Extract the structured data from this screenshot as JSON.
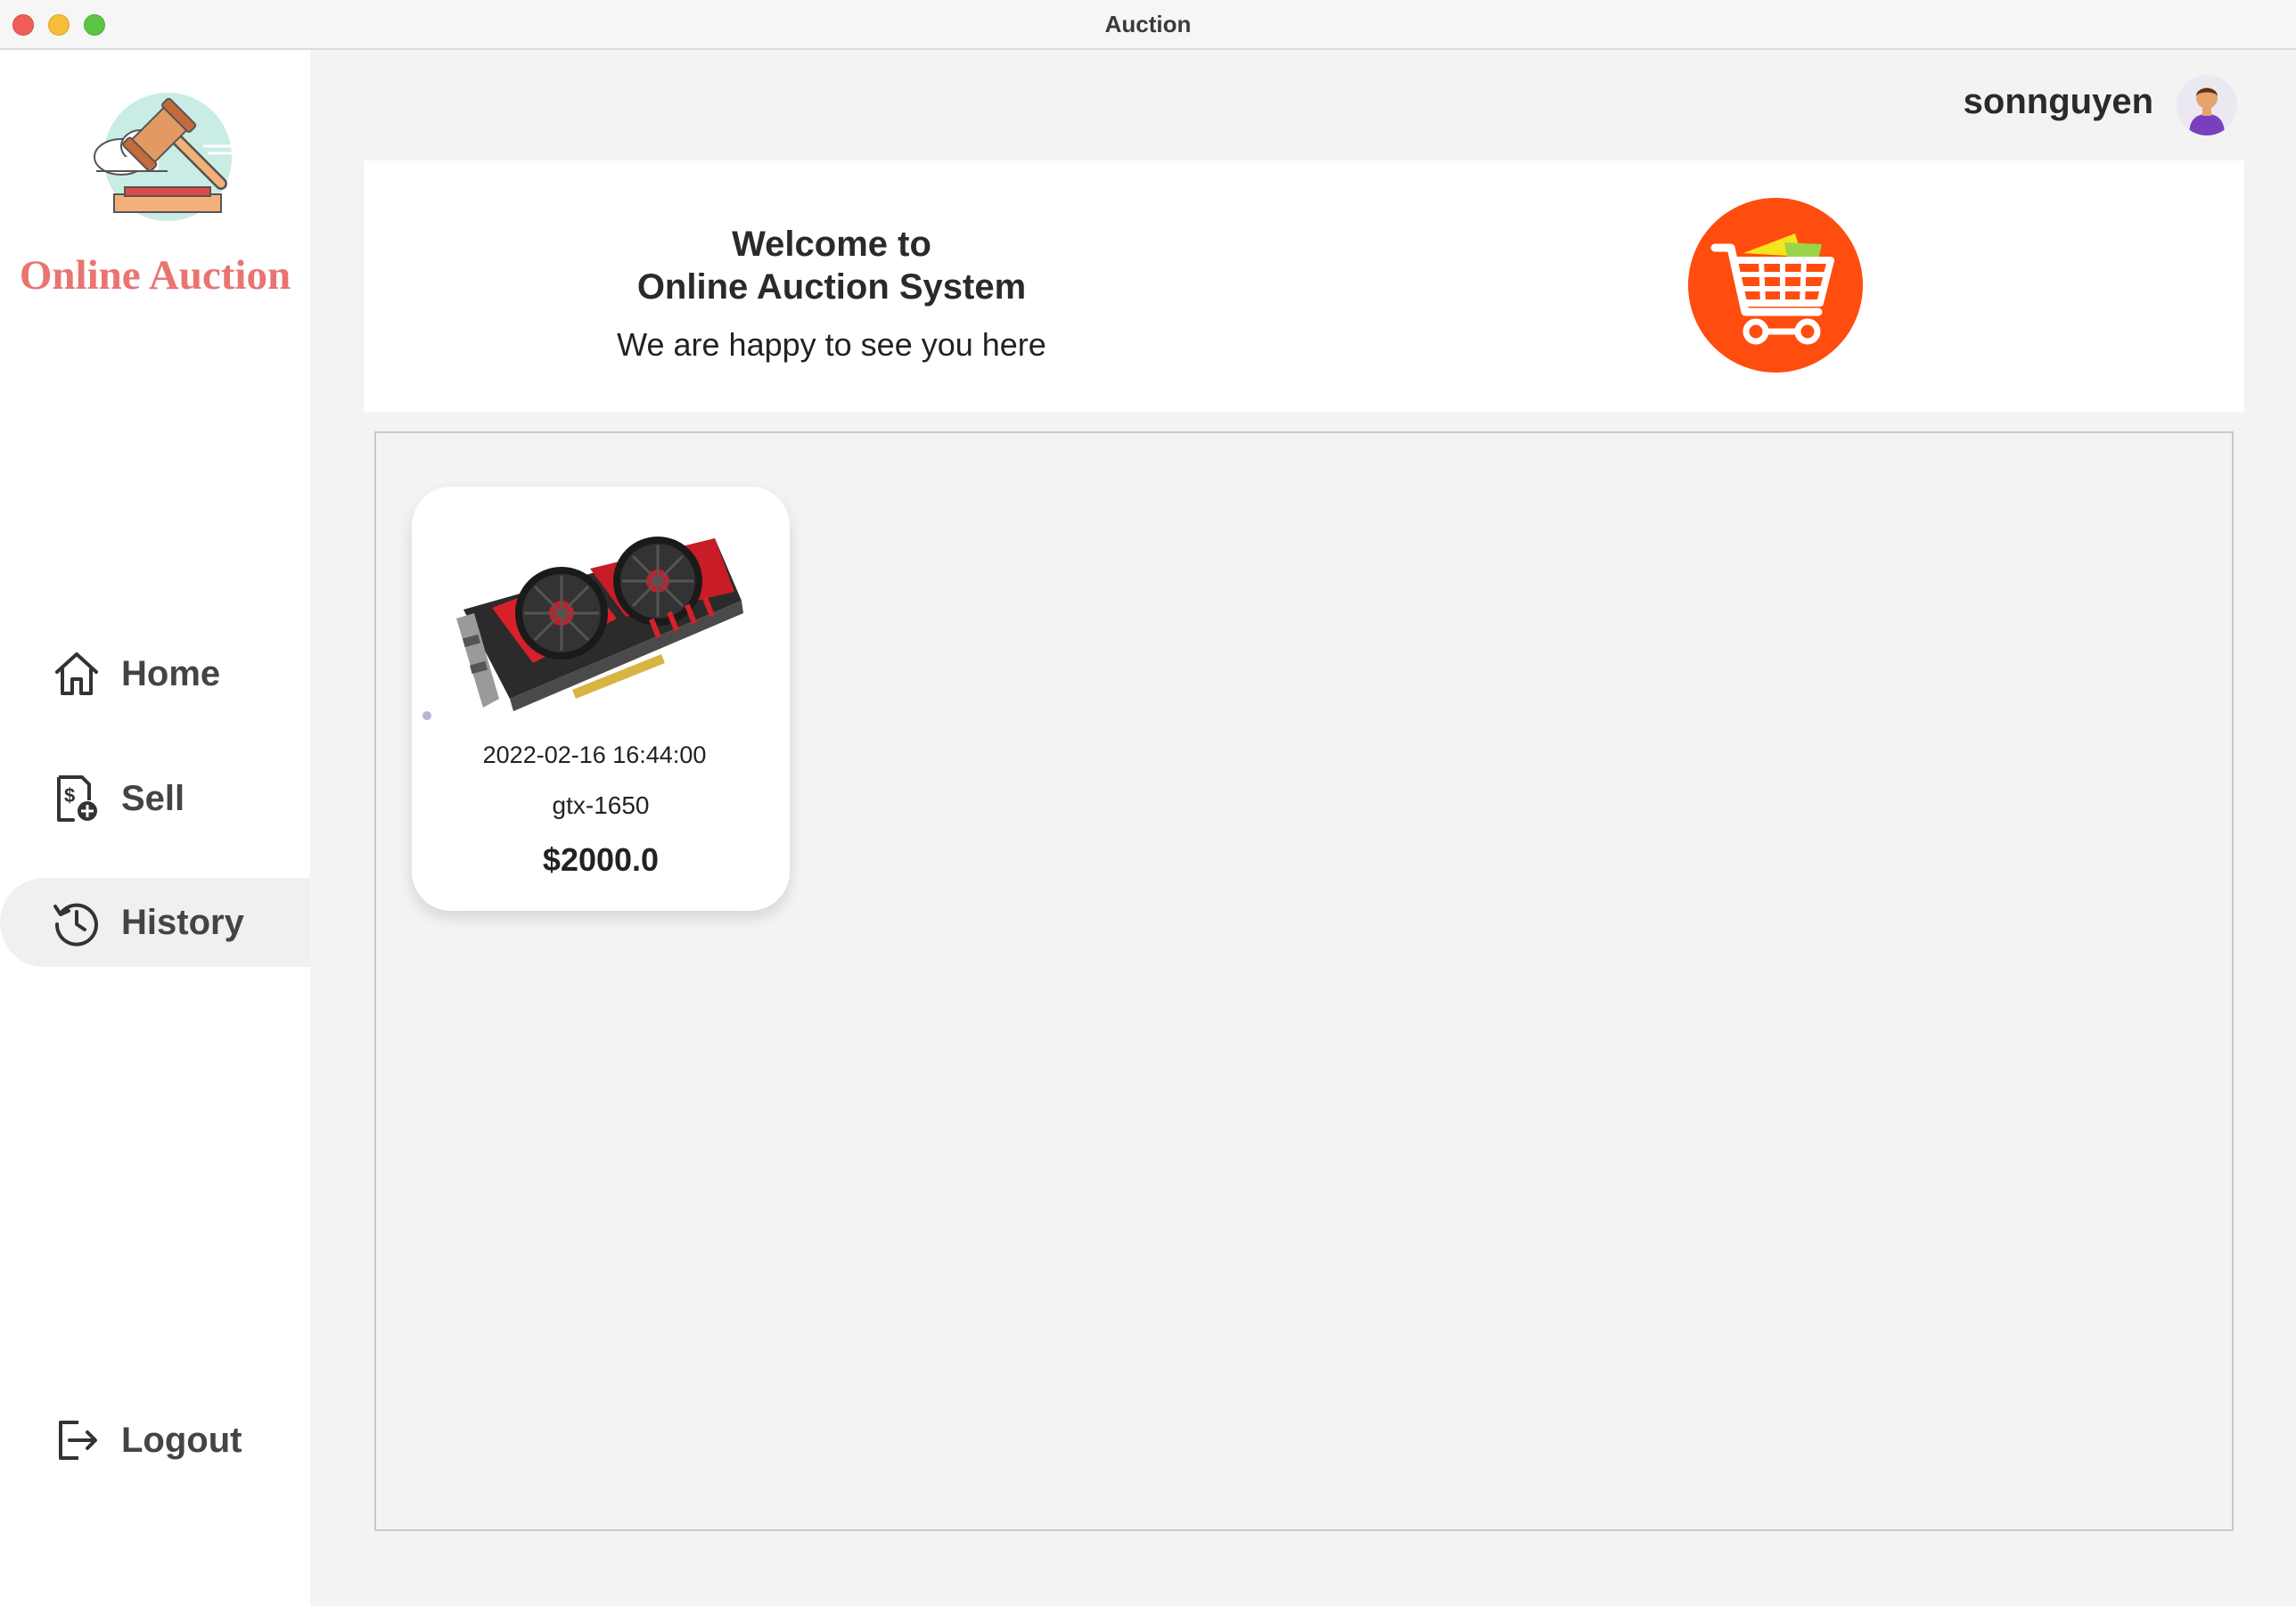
{
  "window": {
    "title": "Auction"
  },
  "sidebar": {
    "brand": "Online Auction",
    "logo_icon": "gavel-cloud-logo",
    "items": [
      {
        "label": "Home",
        "icon": "home-icon",
        "active": false
      },
      {
        "label": "Sell",
        "icon": "sell-document-icon",
        "active": false
      },
      {
        "label": "History",
        "icon": "history-icon",
        "active": true
      }
    ],
    "logout": {
      "label": "Logout",
      "icon": "logout-icon"
    }
  },
  "header": {
    "username": "sonnguyen",
    "avatar_icon": "user-avatar"
  },
  "banner": {
    "line1": "Welcome to",
    "line2": "Online Auction System",
    "subtitle": "We are happy to see you here",
    "icon": "shopping-cart-icon",
    "icon_bg": "#ff4c0f"
  },
  "items": [
    {
      "date": "2022-02-16 16:44:00",
      "name": "gtx-1650",
      "price": "$2000.0",
      "image": "graphics-card-image"
    }
  ],
  "colors": {
    "brand": "#e97472",
    "active_nav_bg": "#f0f0f0",
    "cart_accent": "#ff4c0f"
  }
}
